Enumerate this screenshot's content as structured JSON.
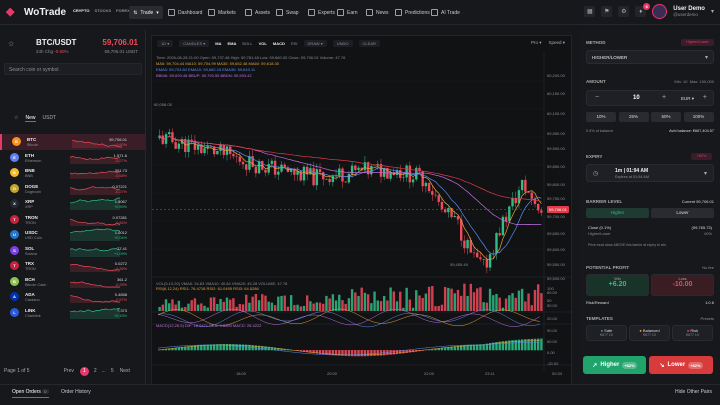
{
  "app": {
    "name": "WoTrade",
    "market_tabs": [
      "CRYPTO",
      "STOCKS",
      "FOREX"
    ],
    "trade_label": "Trade"
  },
  "nav": [
    {
      "label": "Dashboard",
      "icon": "dashboard-icon"
    },
    {
      "label": "Markets",
      "icon": "markets-icon"
    },
    {
      "label": "Assets",
      "icon": "wallet-icon"
    },
    {
      "label": "Swap",
      "icon": "swap-icon"
    },
    {
      "label": "Experts",
      "icon": "experts-icon"
    },
    {
      "label": "Earn",
      "icon": "earn-icon"
    },
    {
      "label": "News",
      "icon": "news-icon"
    },
    {
      "label": "Predictions",
      "icon": "predictions-icon"
    },
    {
      "label": "AI Trade",
      "icon": "ai-icon"
    }
  ],
  "user": {
    "name": "User Demo",
    "handle": "@userdemo",
    "notifications": "6"
  },
  "symbol": {
    "pair": "BTC/USDT",
    "change_label": "24h Chg",
    "change": "-0.60%",
    "price": "59,706.01",
    "price_sub": "59,706.01 USDT"
  },
  "search": {
    "placeholder": "Search coin or symbol"
  },
  "filters": {
    "new": "New",
    "usdt": "USDT"
  },
  "coins": [
    {
      "sym": "BTC",
      "name": "Bitcoin",
      "price": "59,706.01",
      "change": "-0.60%",
      "color": "#f7931a",
      "up": false
    },
    {
      "sym": "ETH",
      "name": "Ethereum",
      "price": "1,571.6",
      "change": "-0.27%",
      "color": "#627eea",
      "up": false
    },
    {
      "sym": "BNB",
      "name": "BNB",
      "price": "301.73",
      "change": "-0.58%",
      "color": "#f3ba2f",
      "up": false
    },
    {
      "sym": "DOGE",
      "name": "Dogecoin",
      "price": "0.07221",
      "change": "-0.27%",
      "color": "#c2a633",
      "up": false
    },
    {
      "sym": "XRP",
      "name": "XRP",
      "price": "1.6067",
      "change": "+0.59%",
      "color": "#23292f",
      "up": true
    },
    {
      "sym": "TRON",
      "name": "TRON",
      "price": "0.07281",
      "change": "-0.84%",
      "color": "#c4253c",
      "up": false
    },
    {
      "sym": "USDC",
      "name": "USD Coin",
      "price": "1.0012",
      "change": "+0.04%",
      "color": "#2775ca",
      "up": true
    },
    {
      "sym": "SOL",
      "name": "Solana",
      "price": "77.41",
      "change": "+1.09%",
      "color": "#7b3fe4",
      "up": true
    },
    {
      "sym": "TRX",
      "name": "TRON",
      "price": "0.0272",
      "change": "-0.36%",
      "color": "#c4253c",
      "up": false
    },
    {
      "sym": "BCH",
      "name": "Bitcoin Cash",
      "price": "361.2",
      "change": "-0.25%",
      "color": "#8dc351",
      "up": false
    },
    {
      "sym": "ADA",
      "name": "Cardano",
      "price": "0.4658",
      "change": "-0.57%",
      "color": "#0033ad",
      "up": false
    },
    {
      "sym": "LINK",
      "name": "Chainlink",
      "price": "7.373",
      "change": "+0.15%",
      "color": "#2a5ada",
      "up": true
    }
  ],
  "pager": {
    "info": "Page 1 of 5",
    "prev": "Prev",
    "p1": "1",
    "p2": "2",
    "dots": "...",
    "p5": "5",
    "next": "Next"
  },
  "chart_toolbar": {
    "tf": "1D",
    "type": "CANDLES",
    "inds": [
      "MA",
      "EMA",
      "BOLL",
      "VOL",
      "MACD",
      "RSI",
      "DRAW"
    ],
    "undo": "UNDO",
    "clear": "CLEAR",
    "pro": "Pro",
    "speed": "Speed"
  },
  "chart_ind": {
    "ohlc": "Time: 2026-08-28 21:00   Open: 59,737.48   High: 59,781.48   Low: 59,660.00   Close: 59,706.01   Volume: 47.76",
    "ma": "MA5: 59,704.44   MA10: 59,704.99   MA30: 59,652.48   MA60: 59,618.30",
    "ema": "EMA5: 59,703.84   EMA10: 59,682.15   EMA30: 59,643.11",
    "bb": "BBMA: 59,693.48   BBUP: 59,793.55   BBDN: 59,593.42",
    "vol": "VOL(5,10,20)   VMA5: 34.83   VMA10: 40.84   VMA20: 45.28   VOLUME: 47.76",
    "rsi": "RSI(6,12,24)   RSI1: 76.4718   RSI2: 61.0495   RSI3: 64.5286",
    "macd": "MACD(12,26,9)   DIF: 18.0471   DEA: 4.8360   MACD: 26.4222"
  },
  "chart_axis": {
    "y": [
      "60,200.00",
      "60,150.00",
      "60,100.00",
      "59,950.00",
      "59,900.00",
      "59,850.00",
      "59,800.00",
      "59,750.00",
      "59,700.00",
      "59,650.00",
      "59,600.00",
      "59,550.00",
      "59,500.00"
    ],
    "last": "59,706.01",
    "hi_label": "60,058.05",
    "lo_label": "59,455.49",
    "vol_y": [
      "100",
      "50"
    ],
    "rsi_y": [
      "80.00",
      "50.00",
      "20.00"
    ],
    "macd_y": [
      "90.00",
      "60.00",
      "0.00",
      "-20.00"
    ],
    "x": [
      "18:00",
      "20:00",
      "22:00",
      "23:11"
    ],
    "time": "00:33"
  },
  "chart_data": {
    "type": "candlestick",
    "title": "BTC/USDT",
    "ylim": [
      59450,
      60200
    ],
    "last": 59706.01
  },
  "trade": {
    "method_label": "METHOD",
    "method_badge": "Higher/Lower",
    "method_value": "HIGHER/LOWER",
    "amount_label": "AMOUNT",
    "min": "Min: 10",
    "max": "Max: 100,000",
    "amount": "10",
    "currency": "EUR",
    "percents": [
      "10%",
      "25%",
      "50%",
      "100%"
    ],
    "balance_note": "0.0% of balance",
    "avail": "Avbl balance: €667,404.57",
    "expiry_label": "EXPIRY",
    "expiry_badge": "+82%",
    "expiry_value": "1m | 01:94 AM",
    "expiry_sub": "Expires at 01:54 AM",
    "barrier_label": "BARRIER LEVEL",
    "barrier_current": "Current 59,706.01",
    "higher": "Higher",
    "lower": "Lower",
    "close_label": "Close (0.1%)",
    "close_val": "(59,765.73)",
    "hl_label": "Higher/Lower",
    "hl_val": "60%",
    "barrier_note": "Price must close ABOVE this barrier at expiry to win.",
    "profit_label": "POTENTIAL PROFIT",
    "profit_note": "No fee",
    "win": "Win",
    "win_val": "+6.20",
    "loss": "Loss",
    "loss_val": "-10.00",
    "rr_label": "Risk/Reward",
    "rr_val": "1:0.6",
    "templates_label": "TEMPLATES",
    "templates_link": "Presets",
    "templates": [
      {
        "name": "Safe",
        "sub": "€677 10",
        "color": "#2ebd85"
      },
      {
        "name": "Balanced",
        "sub": "€677 10",
        "color": "#e3a33a"
      },
      {
        "name": "Risk",
        "sub": "€677 10",
        "color": "#ef4a5a"
      }
    ],
    "btn_higher": "Higher",
    "btn_higher_pct": "+82%",
    "btn_lower": "Lower",
    "btn_lower_pct": "+82%"
  },
  "bottom": {
    "open_orders": "Open Orders",
    "open_count": "0",
    "order_history": "Order History",
    "hide_pairs": "Hide Other Pairs"
  }
}
